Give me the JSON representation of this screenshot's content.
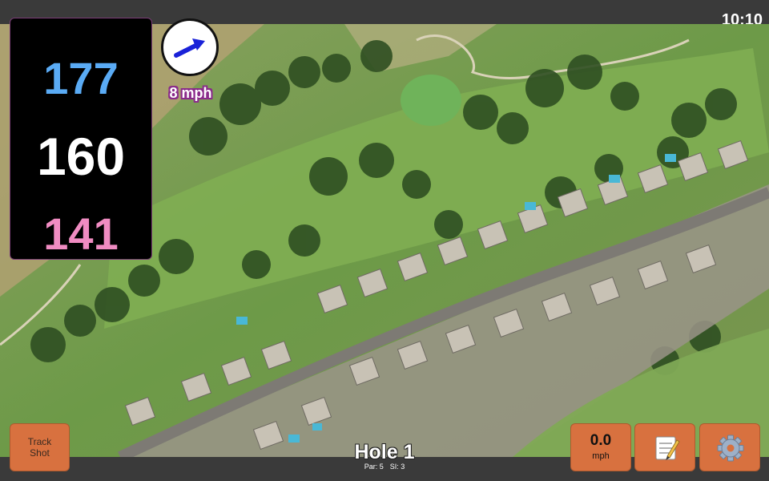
{
  "status": {
    "clock": "10:10"
  },
  "distances": {
    "back": "177",
    "middle": "160",
    "front": "141"
  },
  "wind": {
    "speed_label": "8 mph",
    "icon": "wind-direction-arrow-icon"
  },
  "track_shot": {
    "label_line1": "Track",
    "label_line2": "Shot"
  },
  "speed": {
    "value": "0.0",
    "unit": "mph"
  },
  "notes": {
    "icon": "notepad-icon"
  },
  "settings": {
    "icon": "gear-icon"
  },
  "hole": {
    "title": "Hole 1",
    "par": "Par: 5",
    "si": "SI: 3"
  },
  "colors": {
    "back": "#5aabf5",
    "middle": "#ffffff",
    "front": "#f08cc2",
    "button": "#d8713f",
    "bar": "#3a3a3a"
  }
}
